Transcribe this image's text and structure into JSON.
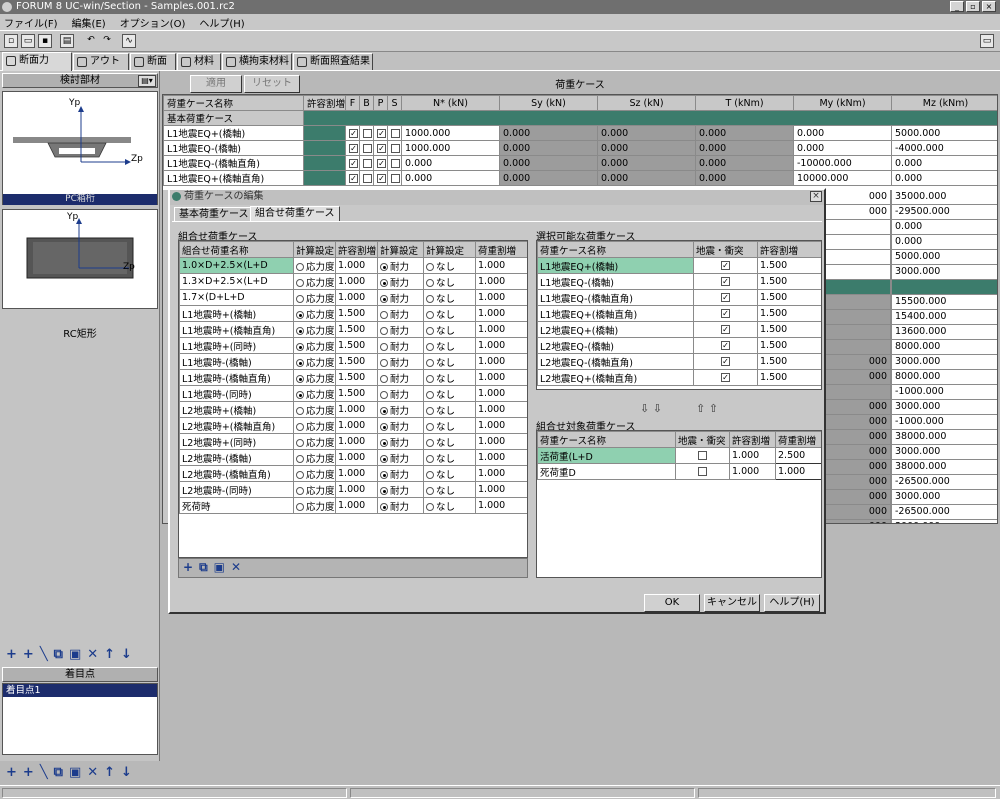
{
  "window": {
    "title": "FORUM 8  UC-win/Section - Samples.001.rc2"
  },
  "menu": [
    "ファイル(F)",
    "編集(E)",
    "オプション(O)",
    "ヘルプ(H)"
  ],
  "tabs": [
    "断面力",
    "アウトライン",
    "断面",
    "材料",
    "横拘束材料",
    "断面照査結果"
  ],
  "left": {
    "panel_title": "検討部材",
    "shape1_label": "PC箱桁",
    "shape2_label": "RC矩形",
    "axis_yp": "Yp",
    "axis_zp": "Zp",
    "focus_title": "着目点",
    "focus_item": "着目点1"
  },
  "toolbar2": {
    "apply": "適用",
    "reset": "リセット",
    "title": "荷重ケース"
  },
  "grid": {
    "headers": [
      "荷重ケース名称",
      "許容割増",
      "N* (kN)",
      "Sy (kN)",
      "Sz (kN)",
      "T (kNm)",
      "My (kNm)",
      "Mz (kNm)"
    ],
    "group": "基本荷重ケース",
    "rows": [
      {
        "name": "L1地震EQ+(橋軸)",
        "n": "1000.000",
        "sy": "0.000",
        "sz": "0.000",
        "t": "0.000",
        "my": "0.000",
        "mz": "5000.000"
      },
      {
        "name": "L1地震EQ-(橋軸)",
        "n": "1000.000",
        "sy": "0.000",
        "sz": "0.000",
        "t": "0.000",
        "my": "0.000",
        "mz": "-4000.000"
      },
      {
        "name": "L1地震EQ-(橋軸直角)",
        "n": "0.000",
        "sy": "0.000",
        "sz": "0.000",
        "t": "0.000",
        "my": "-10000.000",
        "mz": "0.000"
      },
      {
        "name": "L1地震EQ+(橋軸直角)",
        "n": "0.000",
        "sy": "0.000",
        "sz": "0.000",
        "t": "0.000",
        "my": "10000.000",
        "mz": "0.000"
      }
    ],
    "right_values": [
      "35000.000",
      "-29500.000",
      "0.000",
      "0.000",
      "5000.000",
      "3000.000",
      "",
      "15500.000",
      "15400.000",
      "13600.000",
      "8000.000",
      "3000.000",
      "8000.000",
      "-1000.000",
      "3000.000",
      "-1000.000",
      "38000.000",
      "3000.000",
      "38000.000",
      "-26500.000",
      "3000.000",
      "-26500.000",
      "3000.000"
    ],
    "mid_values": [
      "000",
      "000",
      "",
      "",
      "",
      "",
      "",
      "",
      "",
      "",
      "",
      "000",
      "000",
      "",
      "000",
      "000",
      "000",
      "000",
      "000",
      "000",
      "000",
      "000",
      "000"
    ]
  },
  "dialog": {
    "title": "荷重ケースの編集",
    "tab1": "基本荷重ケース",
    "tab2": "組合せ荷重ケース",
    "combo_label": "組合せ荷重ケース",
    "combo_headers": [
      "組合せ荷重名称",
      "計算設定",
      "許容割増",
      "計算設定",
      "計算設定",
      "荷重割増"
    ],
    "combo_rows": [
      {
        "name": "1.0×D+2.5×(L+D",
        "opt": "応力度",
        "v1": "1.000",
        "sel": 2,
        "v2": "1.000"
      },
      {
        "name": "1.3×D+2.5×(L+D",
        "opt": "応力度",
        "v1": "1.000",
        "sel": 2,
        "v2": "1.000"
      },
      {
        "name": "1.7×(D+L+D",
        "opt": "応力度",
        "v1": "1.000",
        "sel": 2,
        "v2": "1.000"
      },
      {
        "name": "L1地震時+(橋軸)",
        "opt": "応力度",
        "v1": "1.500",
        "sel": 1,
        "v2": "1.000"
      },
      {
        "name": "L1地震時+(橋軸直角)",
        "opt": "応力度",
        "v1": "1.500",
        "sel": 1,
        "v2": "1.000"
      },
      {
        "name": "L1地震時+(同時)",
        "opt": "応力度",
        "v1": "1.500",
        "sel": 1,
        "v2": "1.000"
      },
      {
        "name": "L1地震時-(橋軸)",
        "opt": "応力度",
        "v1": "1.500",
        "sel": 1,
        "v2": "1.000"
      },
      {
        "name": "L1地震時-(橋軸直角)",
        "opt": "応力度",
        "v1": "1.500",
        "sel": 1,
        "v2": "1.000"
      },
      {
        "name": "L1地震時-(同時)",
        "opt": "応力度",
        "v1": "1.500",
        "sel": 1,
        "v2": "1.000"
      },
      {
        "name": "L2地震時+(橋軸)",
        "opt": "応力度",
        "v1": "1.000",
        "sel": 2,
        "v2": "1.000"
      },
      {
        "name": "L2地震時+(橋軸直角)",
        "opt": "応力度",
        "v1": "1.000",
        "sel": 2,
        "v2": "1.000"
      },
      {
        "name": "L2地震時+(同時)",
        "opt": "応力度",
        "v1": "1.000",
        "sel": 2,
        "v2": "1.000"
      },
      {
        "name": "L2地震時-(橋軸)",
        "opt": "応力度",
        "v1": "1.000",
        "sel": 2,
        "v2": "1.000"
      },
      {
        "name": "L2地震時-(橋軸直角)",
        "opt": "応力度",
        "v1": "1.000",
        "sel": 2,
        "v2": "1.000"
      },
      {
        "name": "L2地震時-(同時)",
        "opt": "応力度",
        "v1": "1.000",
        "sel": 2,
        "v2": "1.000"
      },
      {
        "name": "死荷時",
        "opt": "応力度",
        "v1": "1.000",
        "sel": 2,
        "v2": "1.000"
      }
    ],
    "opt_a": "耐力",
    "opt_b": "なし",
    "sel_label": "選択可能な荷重ケース",
    "sel_headers": [
      "荷重ケース名称",
      "地震・衝突",
      "許容割増"
    ],
    "sel_rows": [
      {
        "name": "L1地震EQ+(橋軸)",
        "v": "1.500"
      },
      {
        "name": "L1地震EQ-(橋軸)",
        "v": "1.500"
      },
      {
        "name": "L1地震EQ-(橋軸直角)",
        "v": "1.500"
      },
      {
        "name": "L1地震EQ+(橋軸直角)",
        "v": "1.500"
      },
      {
        "name": "L2地震EQ+(橋軸)",
        "v": "1.500"
      },
      {
        "name": "L2地震EQ-(橋軸)",
        "v": "1.500"
      },
      {
        "name": "L2地震EQ-(橋軸直角)",
        "v": "1.500"
      },
      {
        "name": "L2地震EQ+(橋軸直角)",
        "v": "1.500"
      }
    ],
    "tgt_label": "組合せ対象荷重ケース",
    "tgt_headers": [
      "荷重ケース名称",
      "地震・衝突",
      "許容割増",
      "荷重割増"
    ],
    "tgt_rows": [
      {
        "name": "活荷重(L+D",
        "v1": "1.000",
        "v2": "2.500"
      },
      {
        "name": "死荷重D",
        "v1": "1.000",
        "v2": "1.000"
      }
    ],
    "ok": "OK",
    "cancel": "キャンセル",
    "help": "ヘルプ(H)"
  },
  "colors": {
    "teal": "#3c7c6c",
    "highlight": "#8fd0b0",
    "title_bg": "#6f6f6f"
  }
}
